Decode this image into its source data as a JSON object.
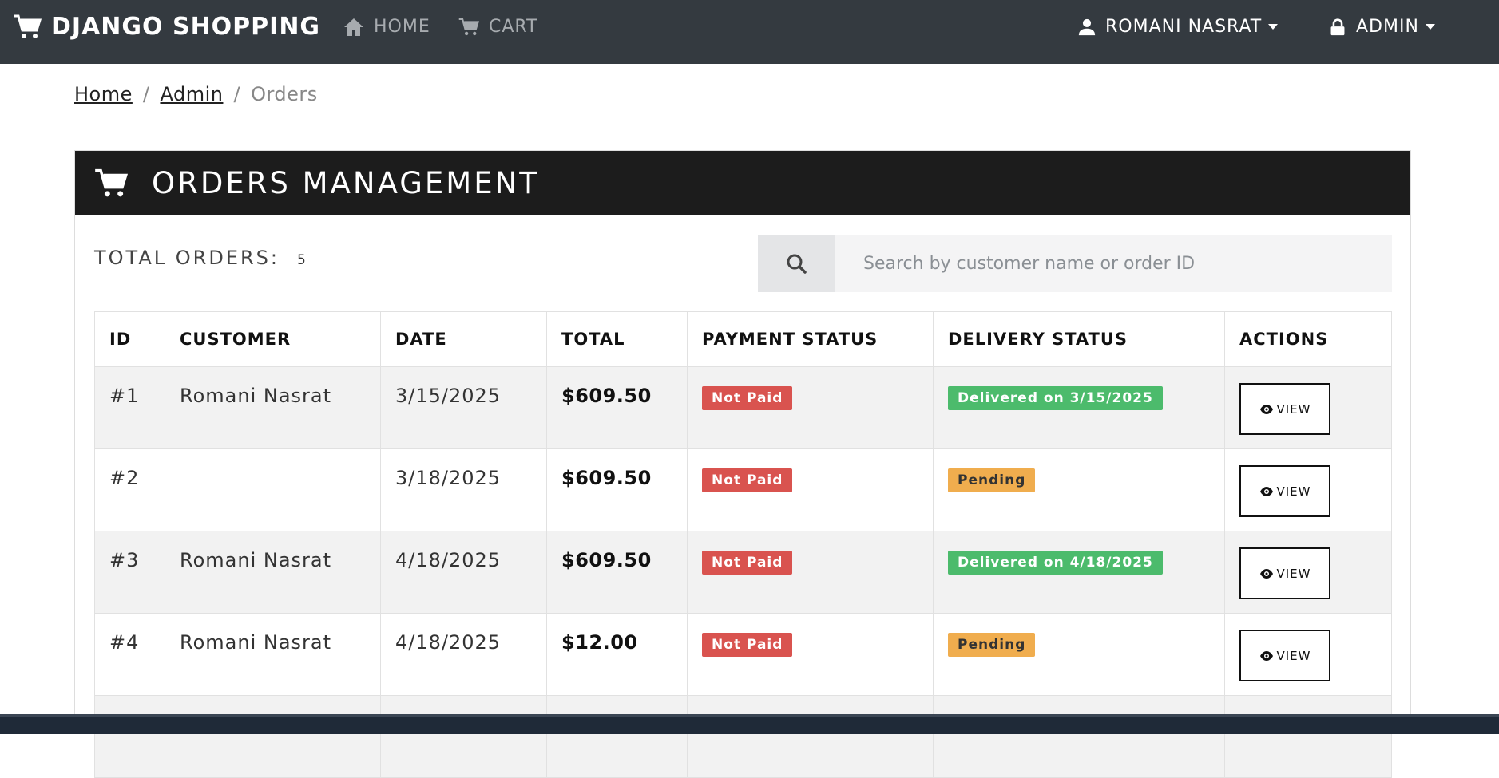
{
  "navbar": {
    "brand": "DJANGO SHOPPING",
    "home": "HOME",
    "cart": "CART",
    "user": "ROMANI NASRAT",
    "admin": "ADMIN"
  },
  "breadcrumb": {
    "home": "Home",
    "sep1": "/",
    "admin": "Admin",
    "sep2": "/",
    "current": "Orders"
  },
  "card": {
    "title": "ORDERS MANAGEMENT",
    "total_label": "TOTAL ORDERS:",
    "total_count": "5",
    "search_placeholder": "Search by customer name or order ID"
  },
  "table": {
    "headers": [
      "ID",
      "CUSTOMER",
      "DATE",
      "TOTAL",
      "PAYMENT STATUS",
      "DELIVERY STATUS",
      "ACTIONS"
    ],
    "view_label": "VIEW",
    "rows": [
      {
        "id": "#1",
        "customer": "Romani Nasrat",
        "date": "3/15/2025",
        "total": "$609.50",
        "payment": "Not Paid",
        "delivery": "Delivered on 3/15/2025"
      },
      {
        "id": "#2",
        "customer": "",
        "date": "3/18/2025",
        "total": "$609.50",
        "payment": "Not Paid",
        "delivery": "Pending"
      },
      {
        "id": "#3",
        "customer": "Romani Nasrat",
        "date": "4/18/2025",
        "total": "$609.50",
        "payment": "Not Paid",
        "delivery": "Delivered on 4/18/2025"
      },
      {
        "id": "#4",
        "customer": "Romani Nasrat",
        "date": "4/18/2025",
        "total": "$12.00",
        "payment": "Not Paid",
        "delivery": "Pending"
      }
    ]
  },
  "colors": {
    "navbar": "#343a40",
    "card_header": "#1c1c1c",
    "not_paid": "#d9534f",
    "delivered": "#4cbb6c",
    "pending": "#f0ad4e"
  },
  "icons": {
    "brand": "cart-icon",
    "home": "home-icon",
    "cart": "cart-icon",
    "user": "user-icon",
    "admin": "lock-icon",
    "search": "search-icon",
    "view": "eye-icon"
  }
}
